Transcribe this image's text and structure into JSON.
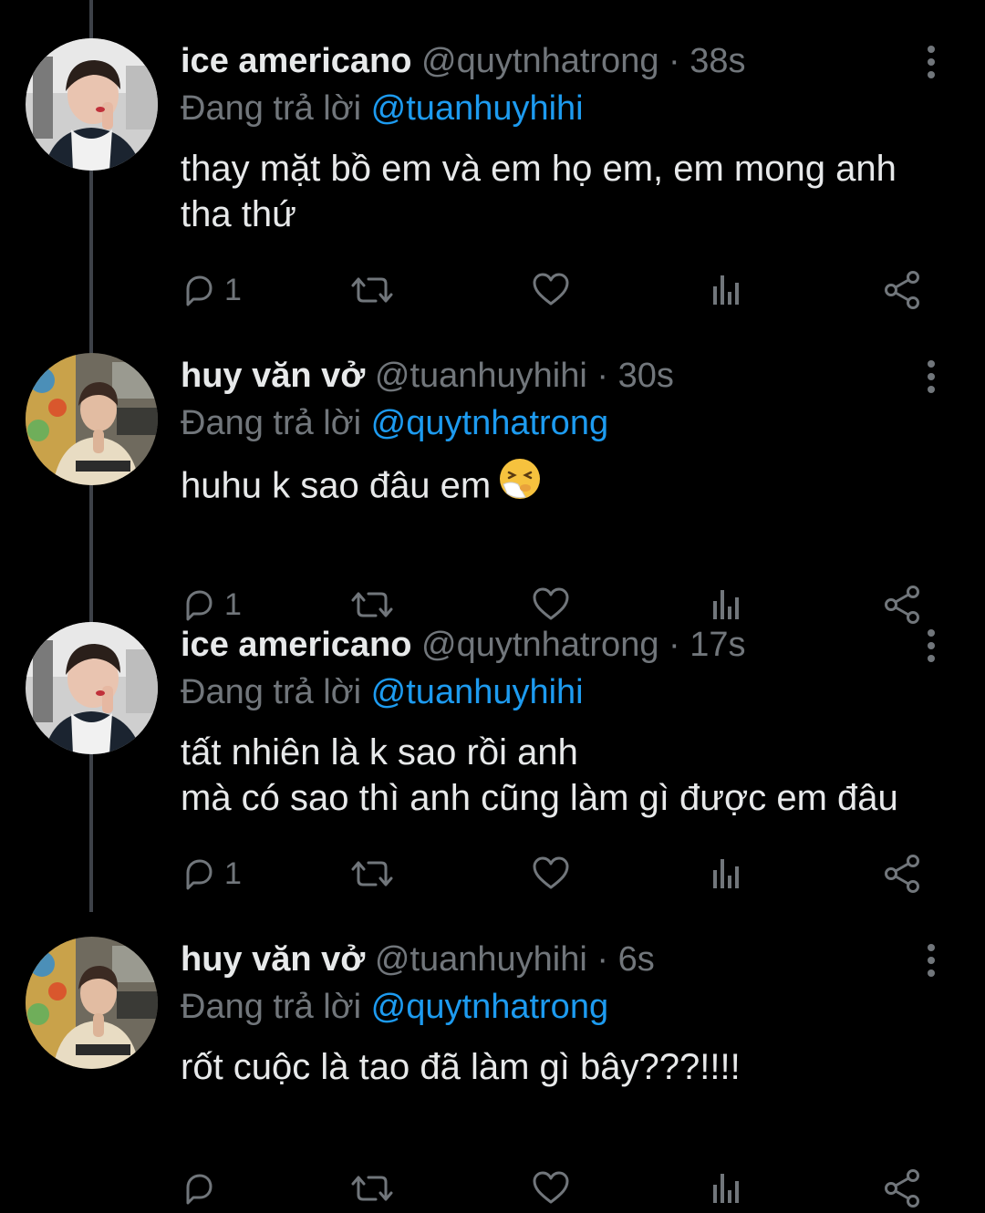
{
  "tweets": [
    {
      "name": "ice americano",
      "handle": "@quytnhatrong",
      "separator": "·",
      "time": "38s",
      "reply_prefix": "Đang trả lời",
      "reply_to": "@tuanhuyhihi",
      "text_lines": [
        "thay mặt bồ em và em họ em, em mong anh",
        "tha thứ"
      ],
      "reply_count": "1",
      "avatar": "avatar-ice-americano"
    },
    {
      "name": "huy văn vở",
      "handle": "@tuanhuyhihi",
      "separator": "·",
      "time": "30s",
      "reply_prefix": "Đang trả lời",
      "reply_to": "@quytnhatrong",
      "text_lines": [
        "huhu k sao đâu em"
      ],
      "emoji": "sneezing-face-emoji",
      "reply_count": "1",
      "avatar": "avatar-huy-van-vo"
    },
    {
      "name": "ice americano",
      "handle": "@quytnhatrong",
      "separator": "·",
      "time": "17s",
      "reply_prefix": "Đang trả lời",
      "reply_to": "@tuanhuyhihi",
      "text_lines": [
        "tất nhiên là k sao rồi anh",
        "mà có sao thì anh cũng làm gì được em đâu"
      ],
      "reply_count": "1",
      "avatar": "avatar-ice-americano"
    },
    {
      "name": "huy văn vở",
      "handle": "@tuanhuyhihi",
      "separator": "·",
      "time": "6s",
      "reply_prefix": "Đang trả lời",
      "reply_to": "@quytnhatrong",
      "text_lines": [
        "rốt cuộc là tao đã làm gì bây???!!!!"
      ],
      "reply_count": "",
      "avatar": "avatar-huy-van-vo"
    }
  ],
  "icons": {
    "reply": "reply-icon",
    "retweet": "retweet-icon",
    "like": "heart-icon",
    "views": "analytics-icon",
    "share": "share-icon",
    "more": "more-vertical-icon"
  },
  "colors": {
    "background": "#000000",
    "primary_text": "#e7e9ea",
    "secondary_text": "#71767b",
    "link": "#1d9bf0",
    "thread_line": "#3d4148"
  }
}
